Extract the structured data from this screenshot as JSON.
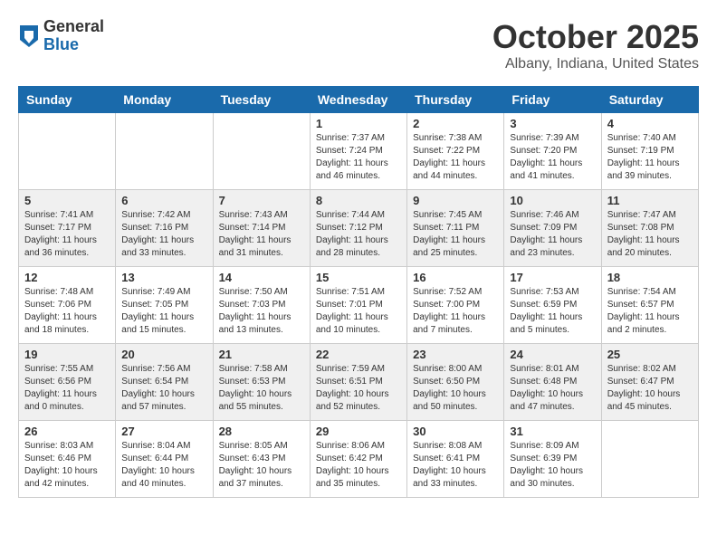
{
  "logo": {
    "general": "General",
    "blue": "Blue"
  },
  "title": "October 2025",
  "location": "Albany, Indiana, United States",
  "weekdays": [
    "Sunday",
    "Monday",
    "Tuesday",
    "Wednesday",
    "Thursday",
    "Friday",
    "Saturday"
  ],
  "weeks": [
    [
      {
        "day": "",
        "info": ""
      },
      {
        "day": "",
        "info": ""
      },
      {
        "day": "",
        "info": ""
      },
      {
        "day": "1",
        "info": "Sunrise: 7:37 AM\nSunset: 7:24 PM\nDaylight: 11 hours and 46 minutes."
      },
      {
        "day": "2",
        "info": "Sunrise: 7:38 AM\nSunset: 7:22 PM\nDaylight: 11 hours and 44 minutes."
      },
      {
        "day": "3",
        "info": "Sunrise: 7:39 AM\nSunset: 7:20 PM\nDaylight: 11 hours and 41 minutes."
      },
      {
        "day": "4",
        "info": "Sunrise: 7:40 AM\nSunset: 7:19 PM\nDaylight: 11 hours and 39 minutes."
      }
    ],
    [
      {
        "day": "5",
        "info": "Sunrise: 7:41 AM\nSunset: 7:17 PM\nDaylight: 11 hours and 36 minutes."
      },
      {
        "day": "6",
        "info": "Sunrise: 7:42 AM\nSunset: 7:16 PM\nDaylight: 11 hours and 33 minutes."
      },
      {
        "day": "7",
        "info": "Sunrise: 7:43 AM\nSunset: 7:14 PM\nDaylight: 11 hours and 31 minutes."
      },
      {
        "day": "8",
        "info": "Sunrise: 7:44 AM\nSunset: 7:12 PM\nDaylight: 11 hours and 28 minutes."
      },
      {
        "day": "9",
        "info": "Sunrise: 7:45 AM\nSunset: 7:11 PM\nDaylight: 11 hours and 25 minutes."
      },
      {
        "day": "10",
        "info": "Sunrise: 7:46 AM\nSunset: 7:09 PM\nDaylight: 11 hours and 23 minutes."
      },
      {
        "day": "11",
        "info": "Sunrise: 7:47 AM\nSunset: 7:08 PM\nDaylight: 11 hours and 20 minutes."
      }
    ],
    [
      {
        "day": "12",
        "info": "Sunrise: 7:48 AM\nSunset: 7:06 PM\nDaylight: 11 hours and 18 minutes."
      },
      {
        "day": "13",
        "info": "Sunrise: 7:49 AM\nSunset: 7:05 PM\nDaylight: 11 hours and 15 minutes."
      },
      {
        "day": "14",
        "info": "Sunrise: 7:50 AM\nSunset: 7:03 PM\nDaylight: 11 hours and 13 minutes."
      },
      {
        "day": "15",
        "info": "Sunrise: 7:51 AM\nSunset: 7:01 PM\nDaylight: 11 hours and 10 minutes."
      },
      {
        "day": "16",
        "info": "Sunrise: 7:52 AM\nSunset: 7:00 PM\nDaylight: 11 hours and 7 minutes."
      },
      {
        "day": "17",
        "info": "Sunrise: 7:53 AM\nSunset: 6:59 PM\nDaylight: 11 hours and 5 minutes."
      },
      {
        "day": "18",
        "info": "Sunrise: 7:54 AM\nSunset: 6:57 PM\nDaylight: 11 hours and 2 minutes."
      }
    ],
    [
      {
        "day": "19",
        "info": "Sunrise: 7:55 AM\nSunset: 6:56 PM\nDaylight: 11 hours and 0 minutes."
      },
      {
        "day": "20",
        "info": "Sunrise: 7:56 AM\nSunset: 6:54 PM\nDaylight: 10 hours and 57 minutes."
      },
      {
        "day": "21",
        "info": "Sunrise: 7:58 AM\nSunset: 6:53 PM\nDaylight: 10 hours and 55 minutes."
      },
      {
        "day": "22",
        "info": "Sunrise: 7:59 AM\nSunset: 6:51 PM\nDaylight: 10 hours and 52 minutes."
      },
      {
        "day": "23",
        "info": "Sunrise: 8:00 AM\nSunset: 6:50 PM\nDaylight: 10 hours and 50 minutes."
      },
      {
        "day": "24",
        "info": "Sunrise: 8:01 AM\nSunset: 6:48 PM\nDaylight: 10 hours and 47 minutes."
      },
      {
        "day": "25",
        "info": "Sunrise: 8:02 AM\nSunset: 6:47 PM\nDaylight: 10 hours and 45 minutes."
      }
    ],
    [
      {
        "day": "26",
        "info": "Sunrise: 8:03 AM\nSunset: 6:46 PM\nDaylight: 10 hours and 42 minutes."
      },
      {
        "day": "27",
        "info": "Sunrise: 8:04 AM\nSunset: 6:44 PM\nDaylight: 10 hours and 40 minutes."
      },
      {
        "day": "28",
        "info": "Sunrise: 8:05 AM\nSunset: 6:43 PM\nDaylight: 10 hours and 37 minutes."
      },
      {
        "day": "29",
        "info": "Sunrise: 8:06 AM\nSunset: 6:42 PM\nDaylight: 10 hours and 35 minutes."
      },
      {
        "day": "30",
        "info": "Sunrise: 8:08 AM\nSunset: 6:41 PM\nDaylight: 10 hours and 33 minutes."
      },
      {
        "day": "31",
        "info": "Sunrise: 8:09 AM\nSunset: 6:39 PM\nDaylight: 10 hours and 30 minutes."
      },
      {
        "day": "",
        "info": ""
      }
    ]
  ]
}
